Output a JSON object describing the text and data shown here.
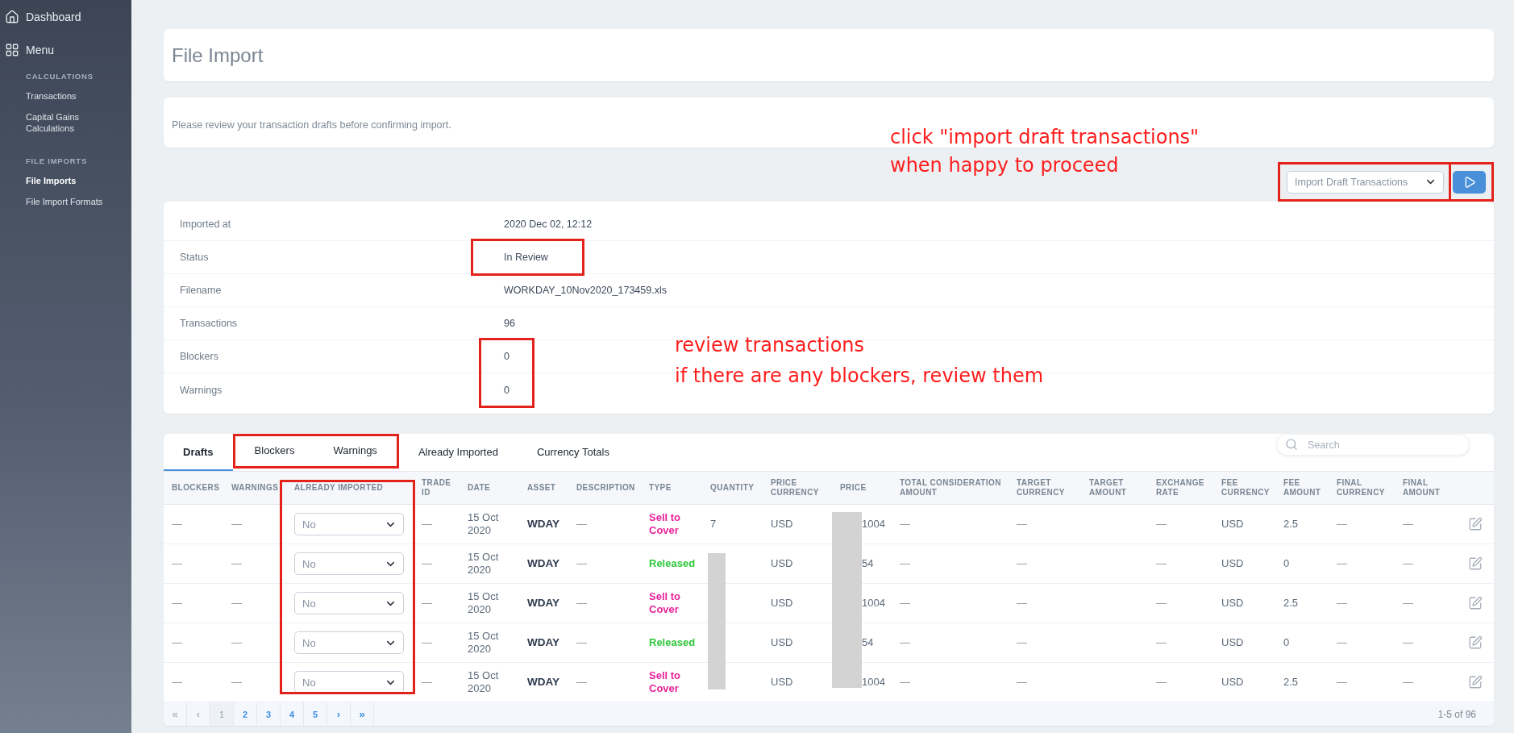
{
  "sidebar": {
    "top_items": [
      {
        "label": "Dashboard"
      },
      {
        "label": "Menu"
      }
    ],
    "sections": [
      {
        "title": "CALCULATIONS",
        "items": [
          {
            "label": "Transactions",
            "selected": false
          },
          {
            "label": "Capital Gains Calculations",
            "selected": false
          }
        ]
      },
      {
        "title": "FILE IMPORTS",
        "items": [
          {
            "label": "File Imports",
            "selected": true
          },
          {
            "label": "File Import Formats",
            "selected": false
          }
        ]
      }
    ]
  },
  "page_title": "File Import",
  "description": "Please review your transaction drafts before confirming import.",
  "actions": {
    "highlighted": true,
    "select": {
      "value": "Import Draft Transactions"
    },
    "run_button": {
      "highlighted": true
    }
  },
  "details": {
    "rows": [
      {
        "label": "Imported at",
        "value": "2020 Dec 02, 12:12",
        "highlighted": false
      },
      {
        "label": "Status",
        "value": "In Review",
        "highlighted": true
      },
      {
        "label": "Filename",
        "value": "WORKDAY_10Nov2020_173459.xls",
        "highlighted": false
      },
      {
        "label": "Transactions",
        "value": "96",
        "highlighted": false
      },
      {
        "label": "Blockers",
        "value": "0",
        "highlighted": true
      },
      {
        "label": "Warnings",
        "value": "0",
        "highlighted": true
      }
    ]
  },
  "tabs": [
    {
      "label": "Drafts",
      "selected": true,
      "highlighted": false
    },
    {
      "label": "Blockers",
      "selected": false,
      "highlighted": true
    },
    {
      "label": "Warnings",
      "selected": false,
      "highlighted": true
    },
    {
      "label": "Already Imported",
      "selected": false,
      "highlighted": false
    },
    {
      "label": "Currency Totals",
      "selected": false,
      "highlighted": false
    }
  ],
  "search": {
    "placeholder": "Search"
  },
  "table": {
    "columns": [
      {
        "label": "BLOCKERS",
        "highlighted": false
      },
      {
        "label": "WARNINGS",
        "highlighted": false
      },
      {
        "label": "ALREADY IMPORTED",
        "highlighted": true
      },
      {
        "label": "TRADE ID",
        "highlighted": false
      },
      {
        "label": "DATE",
        "highlighted": false
      },
      {
        "label": "ASSET",
        "highlighted": false
      },
      {
        "label": "DESCRIPTION",
        "highlighted": false
      },
      {
        "label": "TYPE",
        "highlighted": false
      },
      {
        "label": "QUANTITY",
        "highlighted": false
      },
      {
        "label": "PRICE CURRENCY",
        "highlighted": false
      },
      {
        "label": "PRICE",
        "highlighted": false
      },
      {
        "label": "TOTAL CONSIDERATION AMOUNT",
        "highlighted": false
      },
      {
        "label": "TARGET CURRENCY",
        "highlighted": false
      },
      {
        "label": "TARGET AMOUNT",
        "highlighted": false
      },
      {
        "label": "EXCHANGE RATE",
        "highlighted": false
      },
      {
        "label": "FEE CURRENCY",
        "highlighted": false
      },
      {
        "label": "FEE AMOUNT",
        "highlighted": false
      },
      {
        "label": "FINAL CURRENCY",
        "highlighted": false
      },
      {
        "label": "FINAL AMOUNT",
        "highlighted": false
      }
    ],
    "rows": [
      {
        "blockers": "—",
        "warnings": "—",
        "already_imported": "No",
        "trade_id": "—",
        "date": "15 Oct 2020",
        "asset": "WDAY",
        "description": "—",
        "type": "Sell to Cover",
        "color": "#e8229a",
        "quantity": "7",
        "quantity_redacted": false,
        "price_currency": "USD",
        "price": "1004",
        "price_redacted": true,
        "total_consideration_amount": "—",
        "target_currency": "—",
        "exchange_rate": "—",
        "fee_currency": "USD",
        "fee_amount": "2.5",
        "final_currency": "—",
        "final_amount": "—"
      },
      {
        "blockers": "—",
        "warnings": "—",
        "already_imported": "No",
        "trade_id": "—",
        "date": "15 Oct 2020",
        "asset": "WDAY",
        "description": "—",
        "type": "Released",
        "color": "#2fc73c",
        "quantity_redacted": true,
        "price_currency": "USD",
        "price": "54",
        "price_redacted": true,
        "total_consideration_amount": "—",
        "target_currency": "—",
        "exchange_rate": "—",
        "fee_currency": "USD",
        "fee_amount": "0",
        "final_currency": "—",
        "final_amount": "—"
      },
      {
        "blockers": "—",
        "warnings": "—",
        "already_imported": "No",
        "trade_id": "—",
        "date": "15 Oct 2020",
        "asset": "WDAY",
        "description": "—",
        "type": "Sell to Cover",
        "color": "#e8229a",
        "quantity_redacted": true,
        "price_currency": "USD",
        "price": "1004",
        "price_redacted": true,
        "total_consideration_amount": "—",
        "target_currency": "—",
        "exchange_rate": "—",
        "fee_currency": "USD",
        "fee_amount": "2.5",
        "final_currency": "—",
        "final_amount": "—"
      },
      {
        "blockers": "—",
        "warnings": "—",
        "already_imported": "No",
        "trade_id": "—",
        "date": "15 Oct 2020",
        "asset": "WDAY",
        "description": "—",
        "type": "Released",
        "color": "#2fc73c",
        "quantity_redacted": true,
        "price_currency": "USD",
        "price": "54",
        "price_redacted": true,
        "total_consideration_amount": "—",
        "target_currency": "—",
        "exchange_rate": "—",
        "fee_currency": "USD",
        "fee_amount": "0",
        "final_currency": "—",
        "final_amount": "—"
      },
      {
        "blockers": "—",
        "warnings": "—",
        "already_imported": "No",
        "trade_id": "—",
        "date": "15 Oct 2020",
        "asset": "WDAY",
        "description": "—",
        "type": "Sell to Cover",
        "color": "#e8229a",
        "quantity_redacted": true,
        "price_currency": "USD",
        "price": "1004",
        "price_redacted": true,
        "total_consideration_amount": "—",
        "target_currency": "—",
        "exchange_rate": "—",
        "fee_currency": "USD",
        "fee_amount": "2.5",
        "final_currency": "—",
        "final_amount": "—"
      }
    ]
  },
  "pagination": {
    "items": [
      {
        "kind": "nav",
        "label": "«",
        "disabled": true
      },
      {
        "kind": "nav",
        "label": "‹",
        "disabled": true
      },
      {
        "kind": "page",
        "label": "1",
        "selected": true
      },
      {
        "kind": "page",
        "label": "2",
        "selected": false
      },
      {
        "kind": "page",
        "label": "3",
        "selected": false
      },
      {
        "kind": "page",
        "label": "4",
        "selected": false
      },
      {
        "kind": "page",
        "label": "5",
        "selected": false
      },
      {
        "kind": "nav",
        "label": "›",
        "disabled": false
      },
      {
        "kind": "nav",
        "label": "»",
        "disabled": false
      }
    ],
    "range": "1-5 of 96"
  },
  "annotations": [
    {
      "lines": [
        "click \"import draft transactions\"",
        "when happy to proceed"
      ]
    },
    {
      "lines": [
        "review transactions",
        "if there are any blockers, review them"
      ]
    }
  ]
}
